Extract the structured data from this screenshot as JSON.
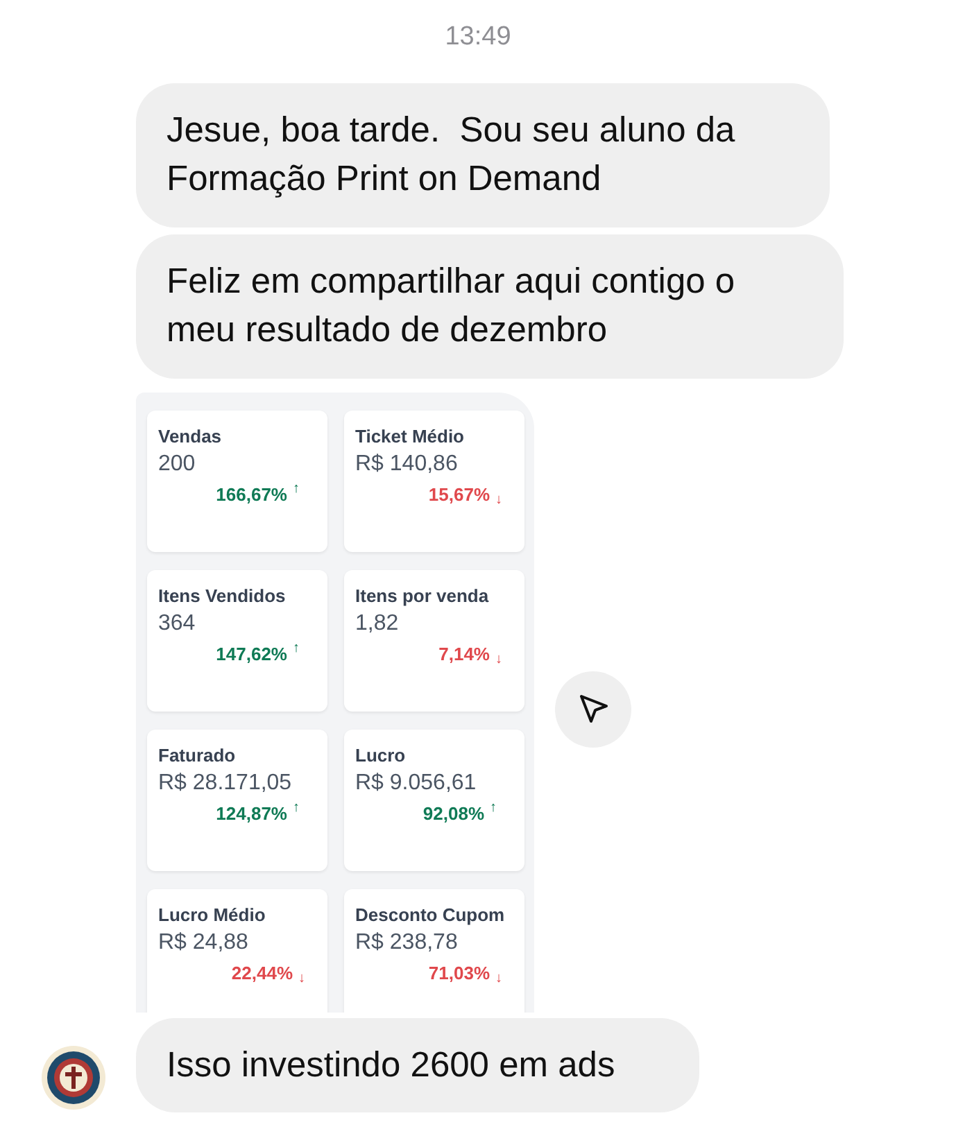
{
  "timestamp": "13:49",
  "messages": [
    {
      "text": "Jesue, boa tarde.  Sou seu aluno da Formação Print on Demand"
    },
    {
      "text": "Feliz em compartilhar aqui contigo o meu resultado de dezembro"
    }
  ],
  "screenshot": {
    "cards": [
      {
        "label": "Vendas",
        "value": "200",
        "change": "166,67%",
        "kind": "up",
        "arrow": "↑"
      },
      {
        "label": "Ticket Médio",
        "value": "R$ 140,86",
        "change": "15,67%",
        "kind": "down",
        "arrow": "↓"
      },
      {
        "label": "Itens Vendidos",
        "value": "364",
        "change": "147,62%",
        "kind": "up",
        "arrow": "↑"
      },
      {
        "label": "Itens por venda",
        "value": "1,82",
        "change": "7,14%",
        "kind": "down",
        "arrow": "↓"
      },
      {
        "label": "Faturado",
        "value": "R$ 28.171,05",
        "change": "124,87%",
        "kind": "up",
        "arrow": "↑"
      },
      {
        "label": "Lucro",
        "value": "R$ 9.056,61",
        "change": "92,08%",
        "kind": "up",
        "arrow": "↑"
      },
      {
        "label": "Lucro Médio",
        "value": "R$ 24,88",
        "change": "22,44%",
        "kind": "down",
        "arrow": "↓"
      },
      {
        "label": "Desconto Cupom",
        "value": "R$ 238,78",
        "change": "71,03%",
        "kind": "down",
        "arrow": "↓"
      }
    ]
  },
  "last_message": {
    "text": "Isso investindo 2600 em ads"
  }
}
